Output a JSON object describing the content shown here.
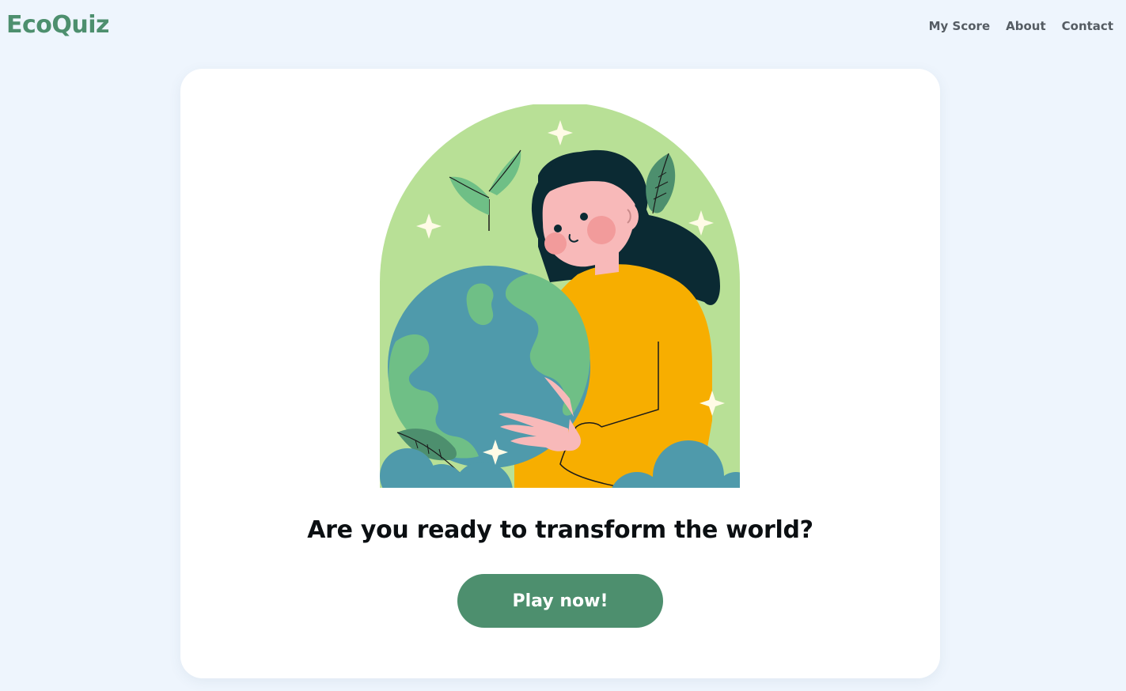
{
  "header": {
    "logo": "EcoQuiz",
    "nav": [
      "My Score",
      "About",
      "Contact"
    ]
  },
  "hero": {
    "illustration_icon": "girl-hugging-earth-illustration",
    "headline": "Are you ready to transform the world?",
    "cta_label": "Play now!"
  },
  "colors": {
    "background": "#eef5fd",
    "brand_green": "#4d8f6e",
    "card": "#ffffff",
    "arch_green": "#b8e096",
    "sweater": "#f7ae00",
    "ocean": "#4f9aab"
  }
}
